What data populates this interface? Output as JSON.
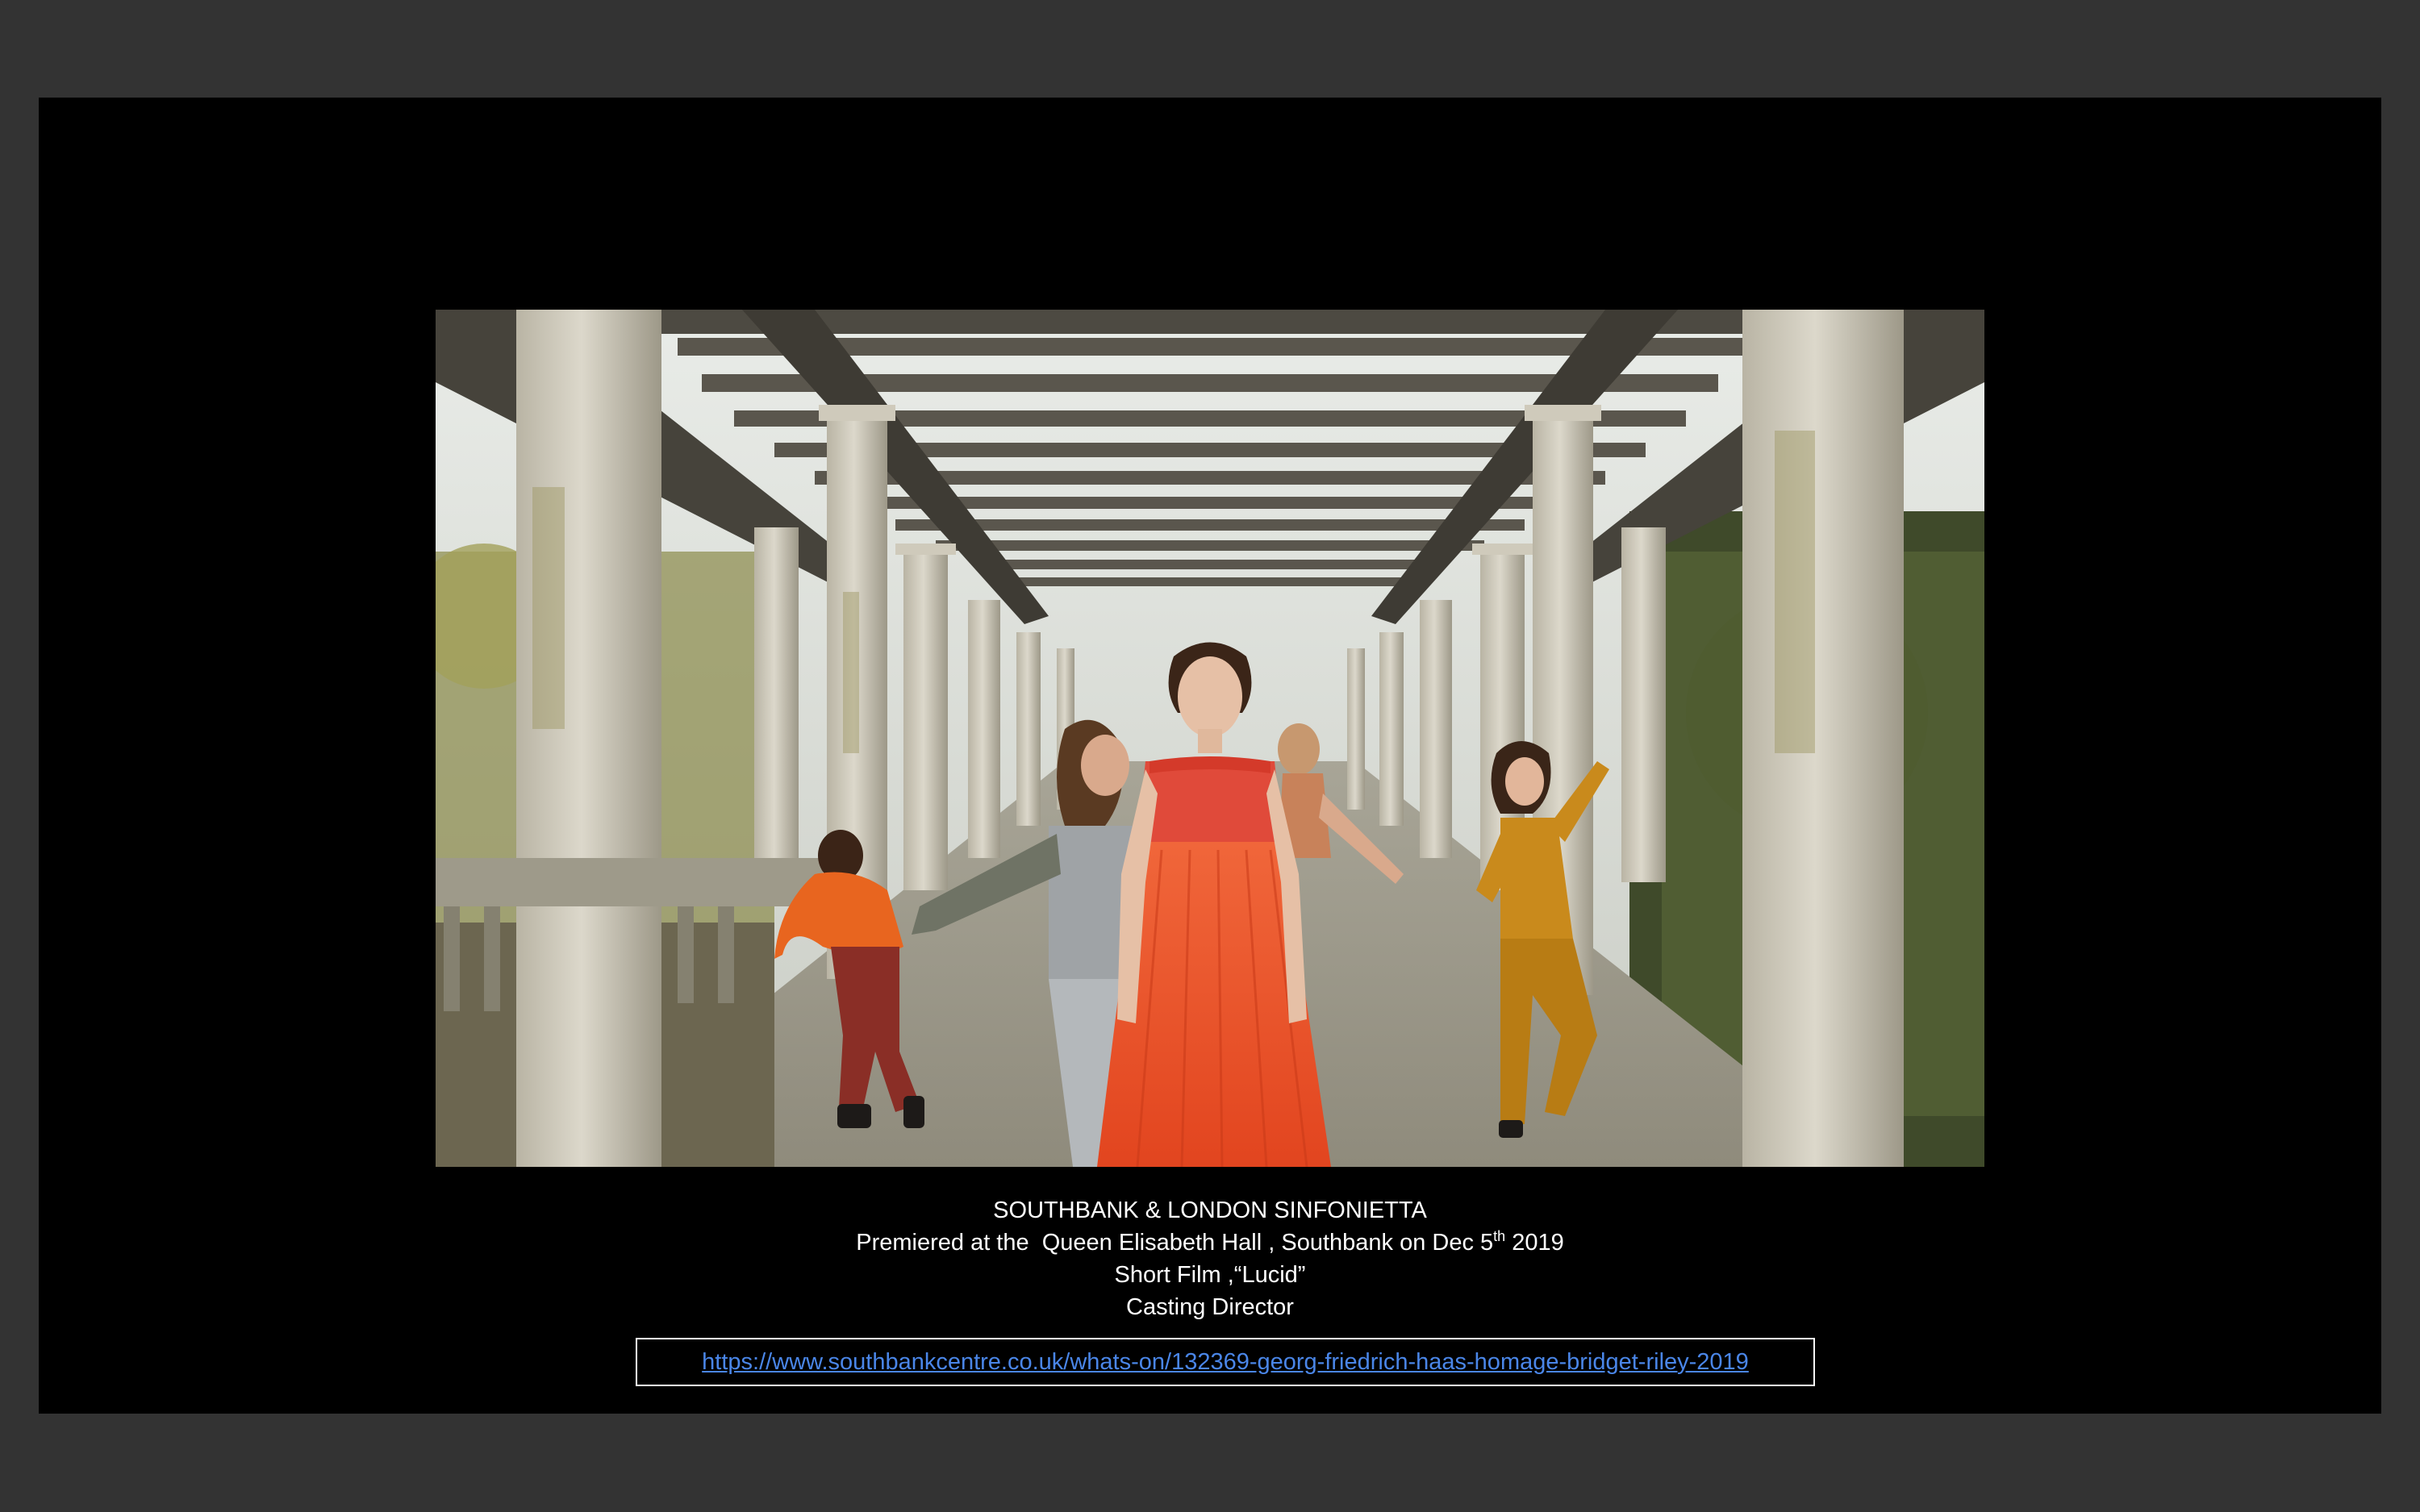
{
  "slide": {
    "photo": {
      "alt": "Dancers in a stone pergola colonnade",
      "accent_colors": {
        "red_dress": "#e8552b",
        "orange_top": "#e8651f",
        "mustard_jumpsuit": "#c98a1c",
        "grey_outfit": "#9fa3a6",
        "maroon_trousers": "#8a2e26"
      }
    },
    "caption": {
      "line1": "SOUTHBANK & LONDON SINFONIETTA",
      "line2_prefix": "Premiered at the  Queen Elisabeth Hall , Southbank on Dec 5",
      "line2_sup": "th",
      "line2_suffix": " 2019",
      "line3": "Short Film ,“Lucid”",
      "line4": "Casting Director"
    },
    "link": {
      "text": "https://www.southbankcentre.co.uk/whats-on/132369-georg-friedrich-haas-homage-bridget-riley-2019",
      "href": "https://www.southbankcentre.co.uk/whats-on/132369-georg-friedrich-haas-homage-bridget-riley-2019"
    }
  }
}
